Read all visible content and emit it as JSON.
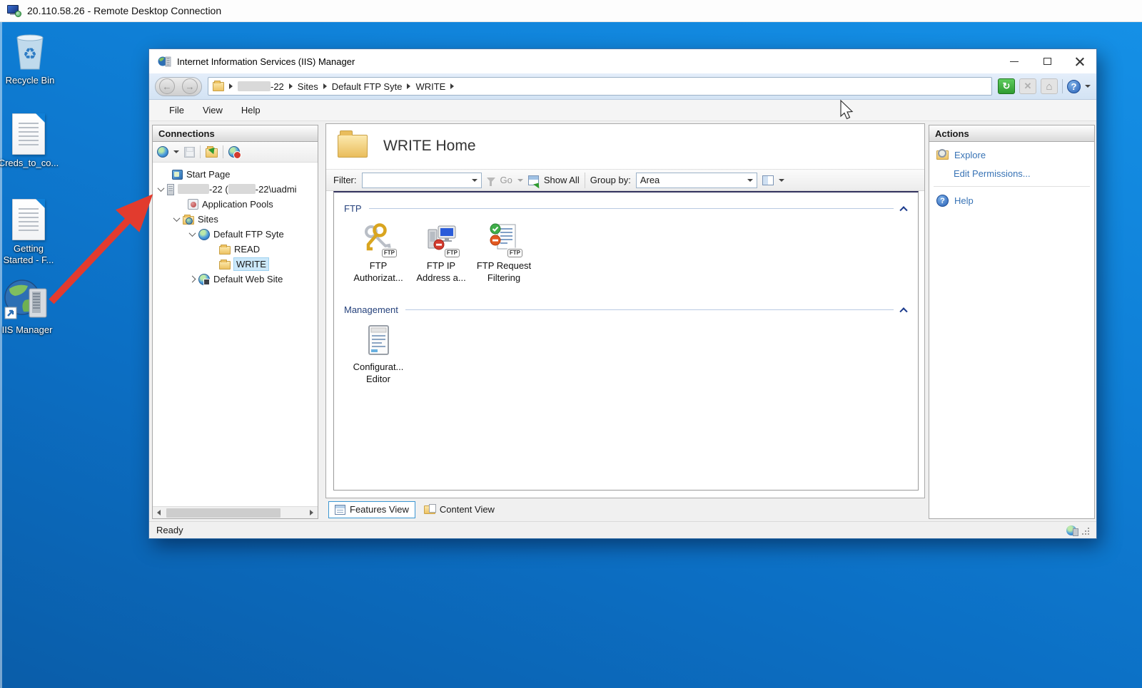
{
  "rdp": {
    "title": "20.110.58.26 - Remote Desktop Connection"
  },
  "desktop": {
    "icons": [
      {
        "label": "Recycle Bin"
      },
      {
        "label": "Creds_to_co..."
      },
      {
        "label": "Getting Started - F..."
      },
      {
        "label": "IIS Manager"
      }
    ]
  },
  "window": {
    "title": "Internet Information Services (IIS) Manager",
    "address": {
      "server_redacted_suffix": "-22",
      "crumbs": {
        "sites": "Sites",
        "ftp_site": "Default FTP Syte",
        "write": "WRITE"
      }
    },
    "menu": {
      "file": "File",
      "view": "View",
      "help": "Help"
    },
    "connections": {
      "title": "Connections",
      "tree": {
        "start_page": "Start Page",
        "server_text_a": "-22 (",
        "server_text_b": "-22\\uadmi",
        "application_pools": "Application Pools",
        "sites": "Sites",
        "default_ftp_site": "Default FTP Syte",
        "read": "READ",
        "write": "WRITE",
        "default_web_site": "Default Web Site"
      }
    },
    "main": {
      "title": "WRITE Home",
      "toolbar": {
        "filter_label": "Filter:",
        "go": "Go",
        "show_all": "Show All",
        "group_by_label": "Group by:",
        "group_by_value": "Area"
      },
      "sections": {
        "ftp": {
          "title": "FTP",
          "items": [
            {
              "label": "FTP Authorizat..."
            },
            {
              "label": "FTP IP Address a..."
            },
            {
              "label": "FTP Request Filtering"
            }
          ]
        },
        "management": {
          "title": "Management",
          "items": [
            {
              "label": "Configurat... Editor"
            }
          ]
        }
      },
      "tabs": {
        "features_view": "Features View",
        "content_view": "Content View"
      }
    },
    "actions": {
      "title": "Actions",
      "explore": "Explore",
      "edit_permissions": "Edit Permissions...",
      "help": "Help"
    },
    "status": {
      "text": "Ready"
    }
  },
  "glyphs": {
    "back_arrow": "←",
    "forward_arrow": "→",
    "refresh": "↻",
    "stop": "✕",
    "home": "⌂",
    "help_question": "?"
  },
  "colors": {
    "desktop_blue": "#0f7fd6",
    "selection_blue": "#cbe8fa",
    "accent_green": "#2f9b30",
    "annotation_red": "#e23b2e",
    "link_blue": "#3873b5",
    "section_navy": "#26427c"
  }
}
